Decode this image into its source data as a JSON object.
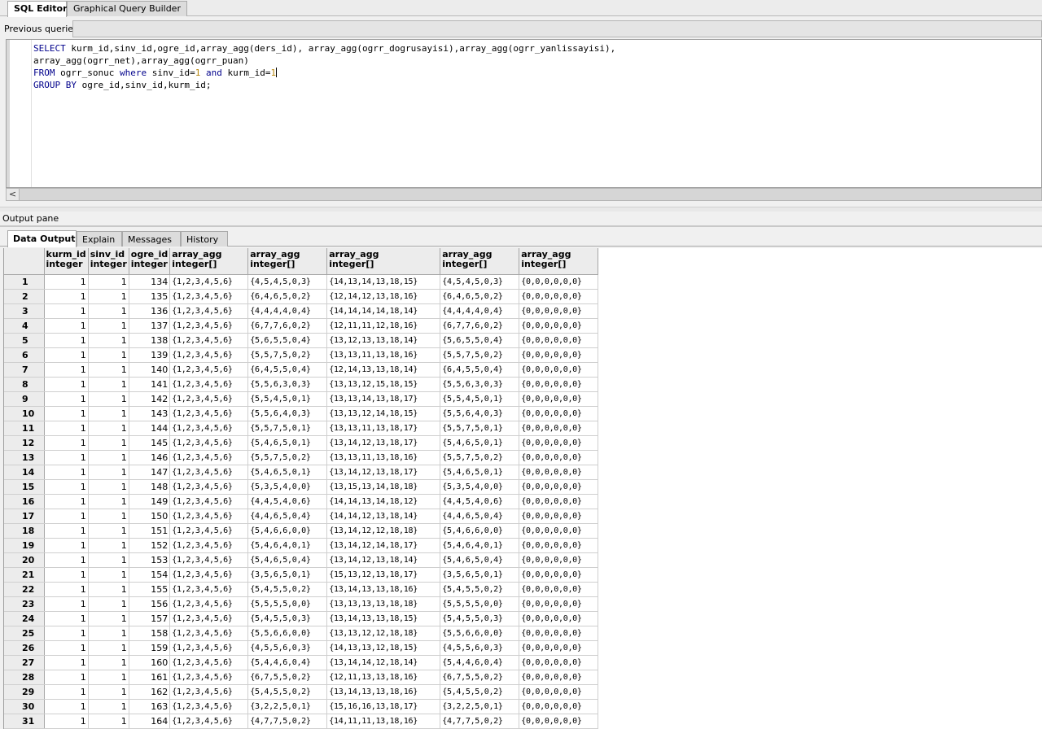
{
  "editor_tabs": [
    {
      "label": "SQL Editor",
      "active": true
    },
    {
      "label": "Graphical Query Builder",
      "active": false
    }
  ],
  "previous_queries_label": "Previous queries",
  "sql": {
    "line1": {
      "select": "SELECT",
      "rest": " kurm_id,sinv_id,ogre_id,array_agg(ders_id), array_agg(ogrr_dogrusayisi),array_agg(ogrr_yanlissayisi),"
    },
    "line2": "array_agg(ogrr_net),array_agg(ogrr_puan)",
    "line3": {
      "from": "FROM",
      "table": " ogrr_sonuc ",
      "where": "where",
      "cond1": " sinv_id=",
      "v1": "1",
      "and": " and",
      "cond2": " kurm_id=",
      "v2": "1"
    },
    "line4": {
      "group": "GROUP BY",
      "rest": " ogre_id,sinv_id,kurm_id;"
    }
  },
  "hscroll_left_arrow": "<",
  "output_pane_label": "Output pane",
  "output_tabs": [
    {
      "label": "Data Output",
      "active": true
    },
    {
      "label": "Explain",
      "active": false
    },
    {
      "label": "Messages",
      "active": false
    },
    {
      "label": "History",
      "active": false
    }
  ],
  "columns": [
    {
      "name": "kurm_id",
      "type": "integer"
    },
    {
      "name": "sinv_id",
      "type": "integer"
    },
    {
      "name": "ogre_id",
      "type": "integer"
    },
    {
      "name": "array_agg",
      "type": "integer[]"
    },
    {
      "name": "array_agg",
      "type": "integer[]"
    },
    {
      "name": "array_agg",
      "type": "integer[]"
    },
    {
      "name": "array_agg",
      "type": "integer[]"
    },
    {
      "name": "array_agg",
      "type": "integer[]"
    }
  ],
  "rows": [
    [
      "1",
      "1",
      "1",
      "134",
      "{1,2,3,4,5,6}",
      "{4,5,4,5,0,3}",
      "{14,13,14,13,18,15}",
      "{4,5,4,5,0,3}",
      "{0,0,0,0,0,0}"
    ],
    [
      "2",
      "1",
      "1",
      "135",
      "{1,2,3,4,5,6}",
      "{6,4,6,5,0,2}",
      "{12,14,12,13,18,16}",
      "{6,4,6,5,0,2}",
      "{0,0,0,0,0,0}"
    ],
    [
      "3",
      "1",
      "1",
      "136",
      "{1,2,3,4,5,6}",
      "{4,4,4,4,0,4}",
      "{14,14,14,14,18,14}",
      "{4,4,4,4,0,4}",
      "{0,0,0,0,0,0}"
    ],
    [
      "4",
      "1",
      "1",
      "137",
      "{1,2,3,4,5,6}",
      "{6,7,7,6,0,2}",
      "{12,11,11,12,18,16}",
      "{6,7,7,6,0,2}",
      "{0,0,0,0,0,0}"
    ],
    [
      "5",
      "1",
      "1",
      "138",
      "{1,2,3,4,5,6}",
      "{5,6,5,5,0,4}",
      "{13,12,13,13,18,14}",
      "{5,6,5,5,0,4}",
      "{0,0,0,0,0,0}"
    ],
    [
      "6",
      "1",
      "1",
      "139",
      "{1,2,3,4,5,6}",
      "{5,5,7,5,0,2}",
      "{13,13,11,13,18,16}",
      "{5,5,7,5,0,2}",
      "{0,0,0,0,0,0}"
    ],
    [
      "7",
      "1",
      "1",
      "140",
      "{1,2,3,4,5,6}",
      "{6,4,5,5,0,4}",
      "{12,14,13,13,18,14}",
      "{6,4,5,5,0,4}",
      "{0,0,0,0,0,0}"
    ],
    [
      "8",
      "1",
      "1",
      "141",
      "{1,2,3,4,5,6}",
      "{5,5,6,3,0,3}",
      "{13,13,12,15,18,15}",
      "{5,5,6,3,0,3}",
      "{0,0,0,0,0,0}"
    ],
    [
      "9",
      "1",
      "1",
      "142",
      "{1,2,3,4,5,6}",
      "{5,5,4,5,0,1}",
      "{13,13,14,13,18,17}",
      "{5,5,4,5,0,1}",
      "{0,0,0,0,0,0}"
    ],
    [
      "10",
      "1",
      "1",
      "143",
      "{1,2,3,4,5,6}",
      "{5,5,6,4,0,3}",
      "{13,13,12,14,18,15}",
      "{5,5,6,4,0,3}",
      "{0,0,0,0,0,0}"
    ],
    [
      "11",
      "1",
      "1",
      "144",
      "{1,2,3,4,5,6}",
      "{5,5,7,5,0,1}",
      "{13,13,11,13,18,17}",
      "{5,5,7,5,0,1}",
      "{0,0,0,0,0,0}"
    ],
    [
      "12",
      "1",
      "1",
      "145",
      "{1,2,3,4,5,6}",
      "{5,4,6,5,0,1}",
      "{13,14,12,13,18,17}",
      "{5,4,6,5,0,1}",
      "{0,0,0,0,0,0}"
    ],
    [
      "13",
      "1",
      "1",
      "146",
      "{1,2,3,4,5,6}",
      "{5,5,7,5,0,2}",
      "{13,13,11,13,18,16}",
      "{5,5,7,5,0,2}",
      "{0,0,0,0,0,0}"
    ],
    [
      "14",
      "1",
      "1",
      "147",
      "{1,2,3,4,5,6}",
      "{5,4,6,5,0,1}",
      "{13,14,12,13,18,17}",
      "{5,4,6,5,0,1}",
      "{0,0,0,0,0,0}"
    ],
    [
      "15",
      "1",
      "1",
      "148",
      "{1,2,3,4,5,6}",
      "{5,3,5,4,0,0}",
      "{13,15,13,14,18,18}",
      "{5,3,5,4,0,0}",
      "{0,0,0,0,0,0}"
    ],
    [
      "16",
      "1",
      "1",
      "149",
      "{1,2,3,4,5,6}",
      "{4,4,5,4,0,6}",
      "{14,14,13,14,18,12}",
      "{4,4,5,4,0,6}",
      "{0,0,0,0,0,0}"
    ],
    [
      "17",
      "1",
      "1",
      "150",
      "{1,2,3,4,5,6}",
      "{4,4,6,5,0,4}",
      "{14,14,12,13,18,14}",
      "{4,4,6,5,0,4}",
      "{0,0,0,0,0,0}"
    ],
    [
      "18",
      "1",
      "1",
      "151",
      "{1,2,3,4,5,6}",
      "{5,4,6,6,0,0}",
      "{13,14,12,12,18,18}",
      "{5,4,6,6,0,0}",
      "{0,0,0,0,0,0}"
    ],
    [
      "19",
      "1",
      "1",
      "152",
      "{1,2,3,4,5,6}",
      "{5,4,6,4,0,1}",
      "{13,14,12,14,18,17}",
      "{5,4,6,4,0,1}",
      "{0,0,0,0,0,0}"
    ],
    [
      "20",
      "1",
      "1",
      "153",
      "{1,2,3,4,5,6}",
      "{5,4,6,5,0,4}",
      "{13,14,12,13,18,14}",
      "{5,4,6,5,0,4}",
      "{0,0,0,0,0,0}"
    ],
    [
      "21",
      "1",
      "1",
      "154",
      "{1,2,3,4,5,6}",
      "{3,5,6,5,0,1}",
      "{15,13,12,13,18,17}",
      "{3,5,6,5,0,1}",
      "{0,0,0,0,0,0}"
    ],
    [
      "22",
      "1",
      "1",
      "155",
      "{1,2,3,4,5,6}",
      "{5,4,5,5,0,2}",
      "{13,14,13,13,18,16}",
      "{5,4,5,5,0,2}",
      "{0,0,0,0,0,0}"
    ],
    [
      "23",
      "1",
      "1",
      "156",
      "{1,2,3,4,5,6}",
      "{5,5,5,5,0,0}",
      "{13,13,13,13,18,18}",
      "{5,5,5,5,0,0}",
      "{0,0,0,0,0,0}"
    ],
    [
      "24",
      "1",
      "1",
      "157",
      "{1,2,3,4,5,6}",
      "{5,4,5,5,0,3}",
      "{13,14,13,13,18,15}",
      "{5,4,5,5,0,3}",
      "{0,0,0,0,0,0}"
    ],
    [
      "25",
      "1",
      "1",
      "158",
      "{1,2,3,4,5,6}",
      "{5,5,6,6,0,0}",
      "{13,13,12,12,18,18}",
      "{5,5,6,6,0,0}",
      "{0,0,0,0,0,0}"
    ],
    [
      "26",
      "1",
      "1",
      "159",
      "{1,2,3,4,5,6}",
      "{4,5,5,6,0,3}",
      "{14,13,13,12,18,15}",
      "{4,5,5,6,0,3}",
      "{0,0,0,0,0,0}"
    ],
    [
      "27",
      "1",
      "1",
      "160",
      "{1,2,3,4,5,6}",
      "{5,4,4,6,0,4}",
      "{13,14,14,12,18,14}",
      "{5,4,4,6,0,4}",
      "{0,0,0,0,0,0}"
    ],
    [
      "28",
      "1",
      "1",
      "161",
      "{1,2,3,4,5,6}",
      "{6,7,5,5,0,2}",
      "{12,11,13,13,18,16}",
      "{6,7,5,5,0,2}",
      "{0,0,0,0,0,0}"
    ],
    [
      "29",
      "1",
      "1",
      "162",
      "{1,2,3,4,5,6}",
      "{5,4,5,5,0,2}",
      "{13,14,13,13,18,16}",
      "{5,4,5,5,0,2}",
      "{0,0,0,0,0,0}"
    ],
    [
      "30",
      "1",
      "1",
      "163",
      "{1,2,3,4,5,6}",
      "{3,2,2,5,0,1}",
      "{15,16,16,13,18,17}",
      "{3,2,2,5,0,1}",
      "{0,0,0,0,0,0}"
    ],
    [
      "31",
      "1",
      "1",
      "164",
      "{1,2,3,4,5,6}",
      "{4,7,7,5,0,2}",
      "{14,11,11,13,18,16}",
      "{4,7,7,5,0,2}",
      "{0,0,0,0,0,0}"
    ]
  ]
}
